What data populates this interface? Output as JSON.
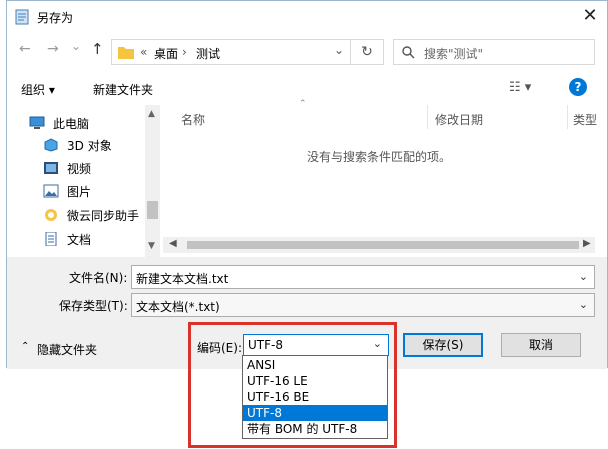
{
  "window": {
    "title": "另存为",
    "close_glyph": "✕"
  },
  "nav": {
    "back_glyph": "←",
    "forward_glyph": "→",
    "recent_glyph": "⌄",
    "up_glyph": "↑",
    "breadcrumb_chevrons": "«",
    "crumbs": [
      "桌面",
      "测试"
    ],
    "crumb_sep": "›",
    "address_dropdown_glyph": "⌄",
    "refresh_glyph": "↻",
    "search_placeholder": "搜索\"测试\""
  },
  "toolbar": {
    "organize": "组织 ▾",
    "new_folder": "新建文件夹",
    "view_glyph": "☷ ▾",
    "help_glyph": "?"
  },
  "sidebar": {
    "items": [
      {
        "label": "此电脑",
        "icon": "computer-icon"
      },
      {
        "label": "3D 对象",
        "icon": "cube-icon"
      },
      {
        "label": "视频",
        "icon": "video-icon"
      },
      {
        "label": "图片",
        "icon": "picture-icon"
      },
      {
        "label": "微云同步助手",
        "icon": "cloud-sync-icon"
      },
      {
        "label": "文档",
        "icon": "document-icon"
      }
    ]
  },
  "list": {
    "columns": [
      "名称",
      "修改日期",
      "类型"
    ],
    "empty_message": "没有与搜索条件匹配的项。"
  },
  "form": {
    "filename_label": "文件名(N):",
    "filename_value": "新建文本文档.txt",
    "filetype_label": "保存类型(T):",
    "filetype_value": "文本文档(*.txt)",
    "hide_folders": "隐藏文件夹",
    "encoding_label": "编码(E):",
    "encoding_value": "UTF-8",
    "save_button": "保存(S)",
    "cancel_button": "取消"
  },
  "encoding_options": [
    "ANSI",
    "UTF-16 LE",
    "UTF-16 BE",
    "UTF-8",
    "带有 BOM 的 UTF-8"
  ],
  "encoding_selected_index": 3,
  "colors": {
    "accent": "#0078d7",
    "highlight_box": "#d9322b",
    "folder": "#f5c542"
  }
}
